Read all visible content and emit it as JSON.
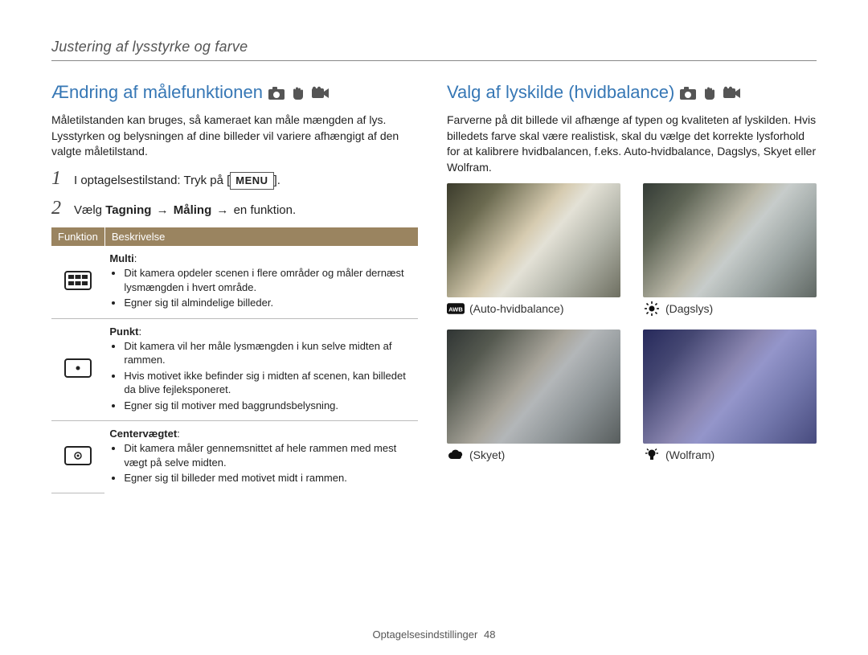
{
  "header": "Justering af lysstyrke og farve",
  "left": {
    "title": "Ændring af målefunktionen",
    "intro": "Måletilstanden kan bruges, så kameraet kan måle mængden af lys. Lysstyrken og belysningen af dine billeder vil variere afhængigt af den valgte måletilstand.",
    "steps": [
      {
        "num": "1",
        "prefix": "I optagelsestilstand: Tryk på [",
        "menu": "MENU",
        "suffix": "]."
      },
      {
        "num": "2",
        "prefix": "Vælg ",
        "b1": "Tagning",
        "arrow1": "→",
        "b2": "Måling",
        "arrow2": "→",
        "tail": " en funktion."
      }
    ],
    "table": {
      "head_icon": "Funktion",
      "head_desc": "Beskrivelse",
      "rows": [
        {
          "title": "Multi",
          "bullets": [
            "Dit kamera opdeler scenen i flere områder og måler dernæst lysmængden i hvert område.",
            "Egner sig til almindelige billeder."
          ]
        },
        {
          "title": "Punkt",
          "bullets": [
            "Dit kamera vil her måle lysmængden i kun selve midten af rammen.",
            "Hvis motivet ikke befinder sig i midten af scenen, kan billedet da blive fejleksponeret.",
            "Egner sig til motiver med baggrundsbelysning."
          ]
        },
        {
          "title": "Centervægtet",
          "bullets": [
            "Dit kamera måler gennemsnittet af hele rammen med mest vægt på selve midten.",
            "Egner sig til billeder med motivet midt i rammen."
          ]
        }
      ]
    }
  },
  "right": {
    "title": "Valg af lyskilde (hvidbalance)",
    "intro": "Farverne på dit billede vil afhænge af typen og kvaliteten af lyskilden. Hvis billedets farve skal være realistisk, skal du vælge det korrekte lysforhold for at kalibrere hvidbalancen, f.eks. Auto-hvidbalance, Dagslys, Skyet eller Wolfram.",
    "wb": [
      {
        "icon": "awb",
        "label": "(Auto-hvidbalance)",
        "tint": "rgba(0,0,0,0)"
      },
      {
        "icon": "sun",
        "label": "(Dagslys)",
        "tint": "rgba(0,60,120,0.12)"
      },
      {
        "icon": "cloud",
        "label": "(Skyet)",
        "tint": "rgba(10,30,80,0.22)"
      },
      {
        "icon": "bulb",
        "label": "(Wolfram)",
        "tint": "rgba(0,10,180,0.35)"
      }
    ]
  },
  "footer": {
    "text": "Optagelsesindstillinger",
    "page": "48"
  }
}
